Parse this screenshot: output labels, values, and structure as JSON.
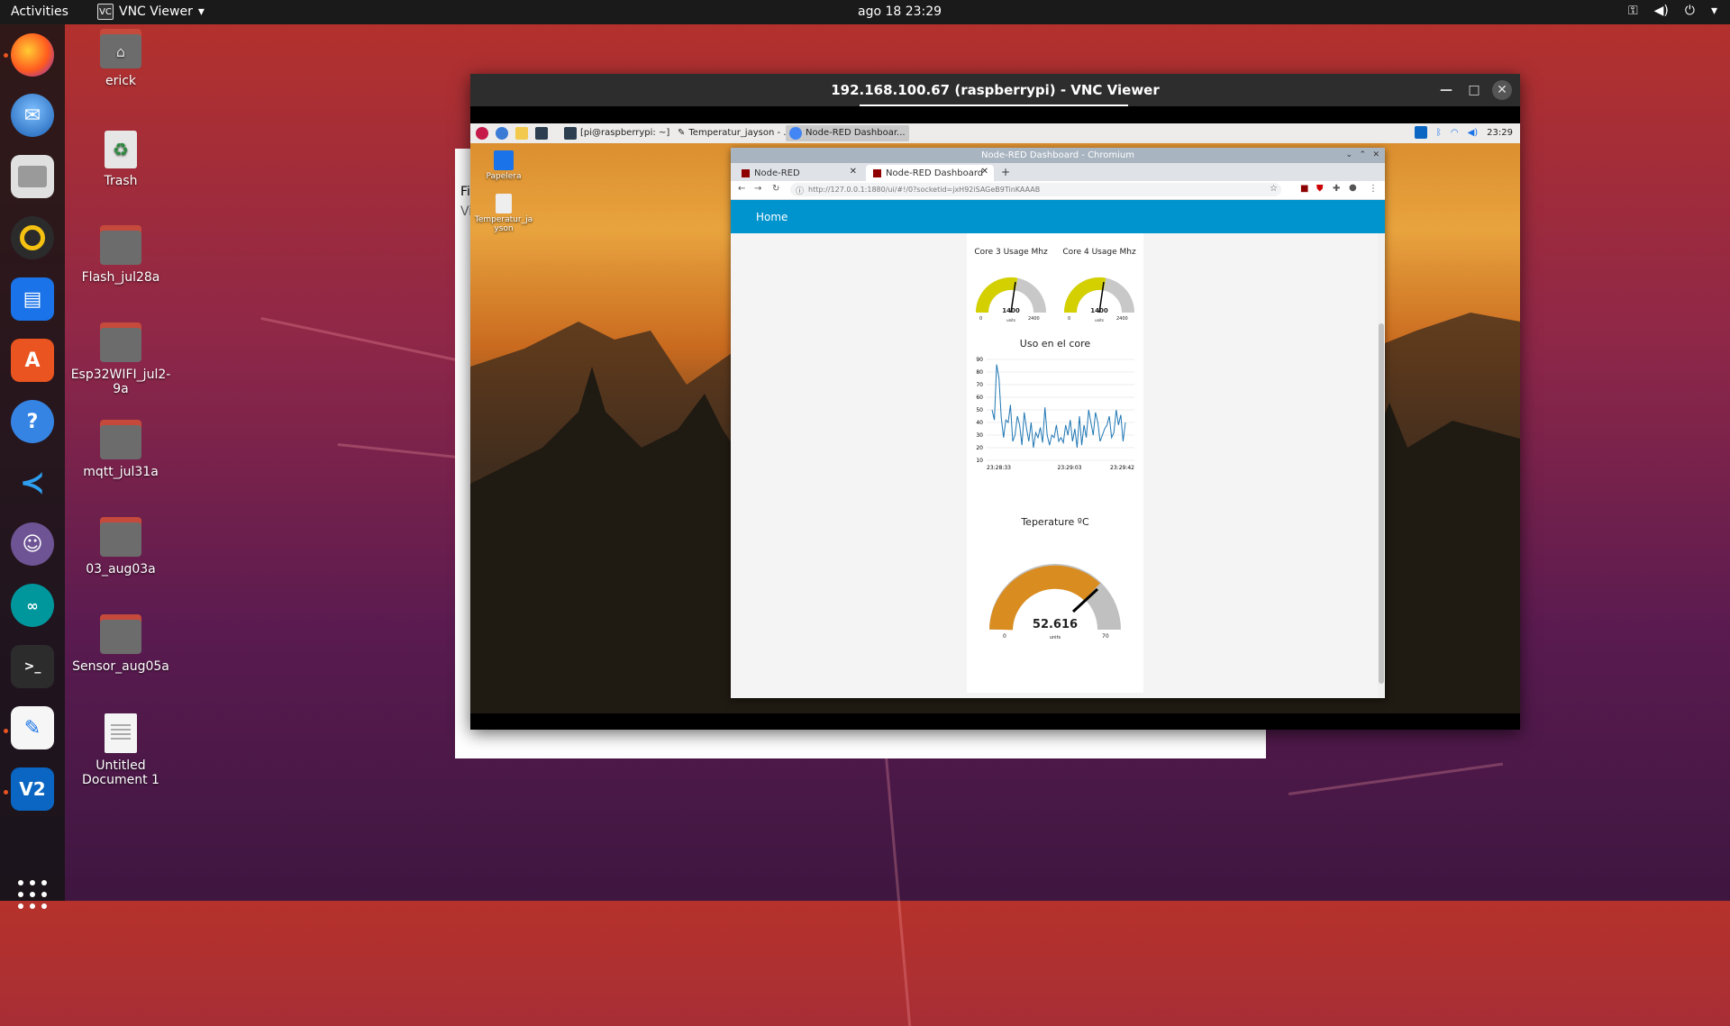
{
  "topbar": {
    "activities": "Activities",
    "app_name": "VNC Viewer",
    "app_icon_text": "VC",
    "clock": "ago 18  23:29"
  },
  "dock": {
    "items": [
      {
        "name": "firefox"
      },
      {
        "name": "thunderbird"
      },
      {
        "name": "files"
      },
      {
        "name": "rhythmbox"
      },
      {
        "name": "libreoffice-writer"
      },
      {
        "name": "ubuntu-software"
      },
      {
        "name": "help"
      },
      {
        "name": "vscode"
      },
      {
        "name": "github-desktop"
      },
      {
        "name": "arduino"
      },
      {
        "name": "terminal"
      },
      {
        "name": "text-editor"
      },
      {
        "name": "vnc-viewer"
      }
    ]
  },
  "desktop": {
    "icons": [
      {
        "label": "erick",
        "kind": "home-folder"
      },
      {
        "label": "Trash",
        "kind": "trash"
      },
      {
        "label": "Flash_jul28a",
        "kind": "folder"
      },
      {
        "label": "Esp32WIFI_jul2-9a",
        "kind": "folder"
      },
      {
        "label": "mqtt_jul31a",
        "kind": "folder"
      },
      {
        "label": "03_aug03a",
        "kind": "folder"
      },
      {
        "label": "Sensor_aug05a",
        "kind": "folder"
      },
      {
        "label": "Untitled Document 1",
        "kind": "document"
      }
    ]
  },
  "back_window": {
    "label_top": "Fi",
    "label_bottom": "Vi"
  },
  "vnc_window": {
    "title": "192.168.100.67 (raspberrypi) - VNC Viewer"
  },
  "remote": {
    "taskbar": {
      "tasks": [
        "[pi@raspberrypi: ~]",
        "Temperatur_jayson - ...",
        "Node-RED Dashboar..."
      ],
      "clock": "23:29"
    },
    "desktop_icons": [
      {
        "label": "Papelera"
      },
      {
        "label": "Temperatur_ja yson"
      }
    ],
    "chromium": {
      "title": "Node-RED Dashboard - Chromium",
      "tabs": [
        "Node-RED",
        "Node-RED Dashboard"
      ],
      "url": "http://127.0.0.1:1880/ui/#!/0?socketid=jxH92iSAGeB9TinKAAAB",
      "header": "Home"
    },
    "dashboard": {
      "gauge_core3": {
        "title": "Core 3 Usage Mhz",
        "value": "1400",
        "min": "0",
        "max": "2400",
        "units": "units"
      },
      "gauge_core4": {
        "title": "Core 4 Usage Mhz",
        "value": "1400",
        "min": "0",
        "max": "2400",
        "units": "units"
      },
      "chart_title": "Uso en el core",
      "temp": {
        "title": "Teperature ºC",
        "value": "52.616",
        "min": "0",
        "max": "70",
        "units": "units"
      }
    }
  },
  "chart_data": {
    "type": "line",
    "title": "Uso en el core",
    "x_ticks": [
      "23:28:33",
      "23:29:03",
      "23:29:42"
    ],
    "y_ticks": [
      10,
      20,
      30,
      40,
      50,
      60,
      70,
      80,
      90
    ],
    "ylim": [
      10,
      90
    ],
    "series": [
      {
        "values": [
          50,
          42,
          86,
          75,
          44,
          28,
          42,
          40,
          54,
          25,
          30,
          45,
          38,
          22,
          48,
          35,
          25,
          40,
          20,
          32,
          28,
          36,
          24,
          52,
          30,
          22,
          30,
          28,
          38,
          25,
          28,
          24,
          38,
          30,
          42,
          25,
          35,
          20,
          45,
          22,
          38,
          28,
          50,
          40,
          30,
          48,
          40,
          25,
          30,
          35,
          38,
          45,
          28,
          32,
          50,
          38,
          46,
          25,
          40
        ]
      }
    ],
    "colors": {
      "line": "#1f77b4"
    }
  }
}
